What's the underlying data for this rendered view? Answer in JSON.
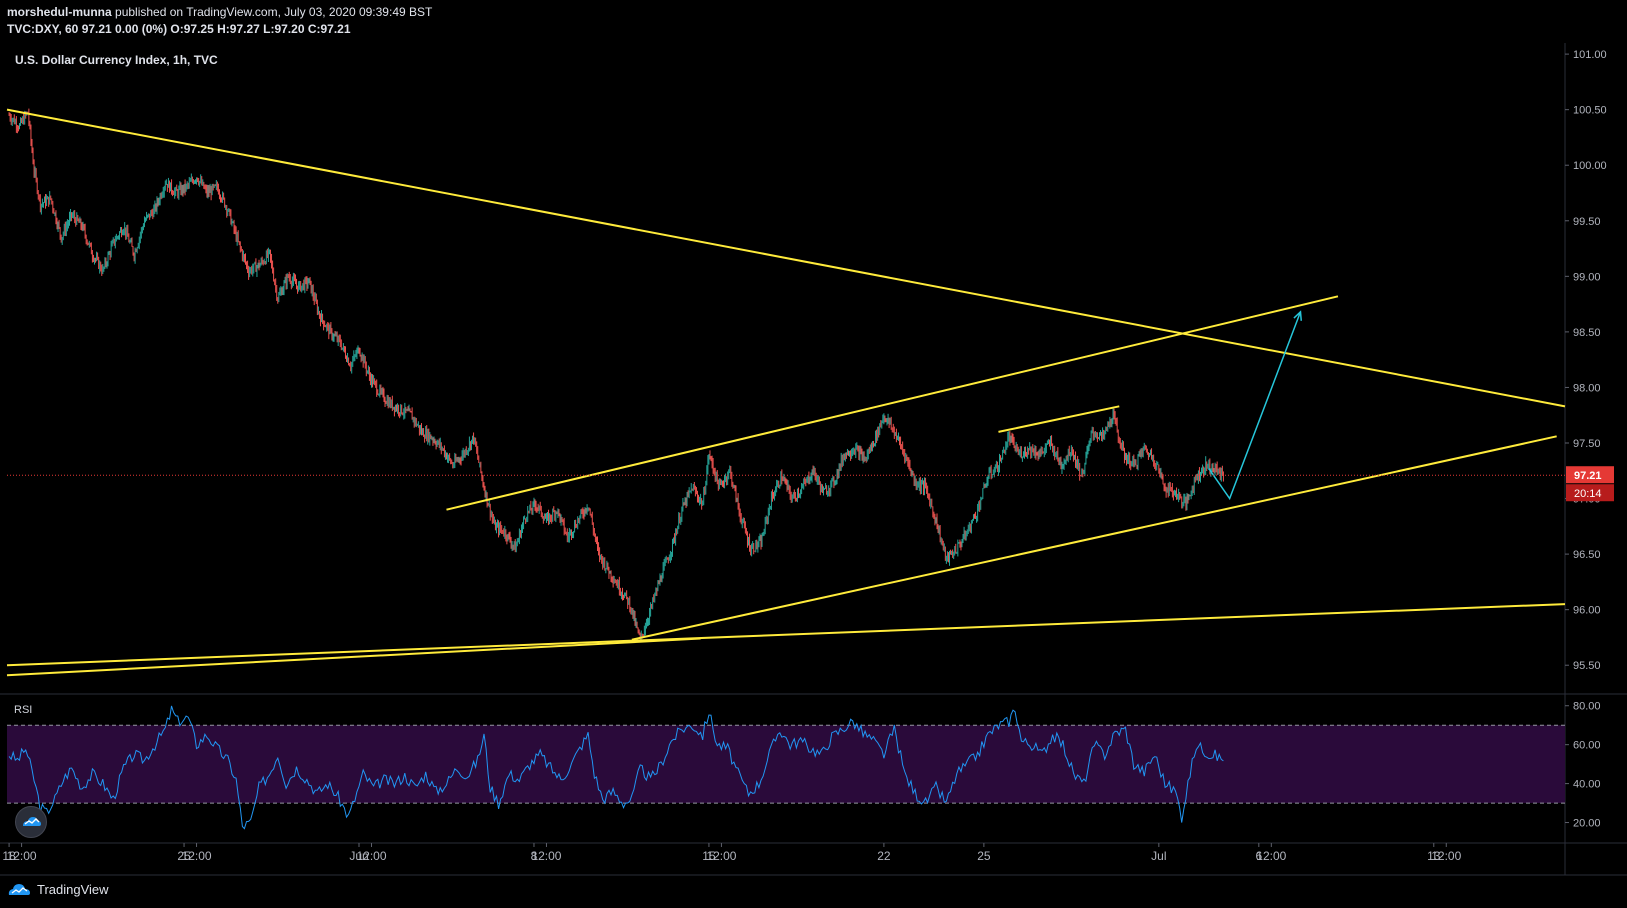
{
  "header": {
    "author": "morshedul-munna",
    "published_text": "published on TradingView.com, July 03, 2020 09:39:49 BST",
    "ticker_line": "TVC:DXY, 60  97.21  0.00 (0%)  O:97.25  H:97.27  L:97.20  C:97.21"
  },
  "chart_title": "U.S. Dollar Currency Index, 1h, TVC",
  "footer": {
    "brand": "TradingView"
  },
  "colors": {
    "background": "#000000",
    "candle_up": "#26a69a",
    "candle_down": "#ef5350",
    "trendline": "#ffeb3b",
    "projection_arrow": "#26c6da",
    "rsi_line": "#2196f3",
    "rsi_band": "#2a0a3a",
    "price_badge": "#e53935"
  },
  "icons": {
    "logo": "tradingview-cloud-icon",
    "badge": "tradingview-badge-icon"
  },
  "chart_data": [
    {
      "type": "candlestick",
      "title": "U.S. Dollar Currency Index, 1h, TVC",
      "symbol": "TVC:DXY",
      "interval": "60",
      "last_price": 97.21,
      "last_price_label": "97.21",
      "countdown_label": "20:14",
      "ylim": [
        95.25,
        101.1
      ],
      "y_ticks": [
        "101.00",
        "100.50",
        "100.00",
        "99.50",
        "99.00",
        "98.50",
        "98.00",
        "97.50",
        "97.00",
        "96.50",
        "96.00",
        "95.50"
      ],
      "x_tick_labels": [
        "18",
        "12:00",
        "25",
        "12:00",
        "Jun",
        "12:00",
        "8",
        "12:00",
        "15",
        "12:00",
        "22",
        "25",
        "Jul",
        "6",
        "12:00",
        "13",
        "12:00"
      ],
      "x_tick_times": [
        0,
        12,
        168,
        180,
        336,
        348,
        504,
        516,
        672,
        684,
        840,
        936,
        1104,
        1200,
        1212,
        1368,
        1380
      ],
      "xlim": [
        -2,
        1494
      ],
      "price_path": [
        [
          0,
          100.45
        ],
        [
          10,
          100.35
        ],
        [
          18,
          100.48
        ],
        [
          24,
          99.95
        ],
        [
          30,
          99.65
        ],
        [
          40,
          99.7
        ],
        [
          50,
          99.35
        ],
        [
          60,
          99.55
        ],
        [
          70,
          99.45
        ],
        [
          80,
          99.2
        ],
        [
          90,
          99.05
        ],
        [
          100,
          99.3
        ],
        [
          110,
          99.45
        ],
        [
          120,
          99.2
        ],
        [
          130,
          99.5
        ],
        [
          140,
          99.6
        ],
        [
          150,
          99.85
        ],
        [
          160,
          99.75
        ],
        [
          170,
          99.8
        ],
        [
          180,
          99.9
        ],
        [
          190,
          99.75
        ],
        [
          200,
          99.8
        ],
        [
          210,
          99.6
        ],
        [
          220,
          99.3
        ],
        [
          230,
          99.05
        ],
        [
          240,
          99.1
        ],
        [
          250,
          99.2
        ],
        [
          258,
          98.8
        ],
        [
          268,
          99.0
        ],
        [
          278,
          98.9
        ],
        [
          288,
          98.95
        ],
        [
          298,
          98.65
        ],
        [
          308,
          98.5
        ],
        [
          318,
          98.4
        ],
        [
          328,
          98.2
        ],
        [
          336,
          98.35
        ],
        [
          346,
          98.1
        ],
        [
          356,
          97.95
        ],
        [
          366,
          97.85
        ],
        [
          376,
          97.8
        ],
        [
          386,
          97.75
        ],
        [
          396,
          97.6
        ],
        [
          406,
          97.55
        ],
        [
          416,
          97.45
        ],
        [
          426,
          97.3
        ],
        [
          436,
          97.4
        ],
        [
          446,
          97.55
        ],
        [
          456,
          97.1
        ],
        [
          466,
          96.75
        ],
        [
          476,
          96.7
        ],
        [
          486,
          96.55
        ],
        [
          496,
          96.85
        ],
        [
          506,
          96.95
        ],
        [
          516,
          96.8
        ],
        [
          526,
          96.9
        ],
        [
          536,
          96.65
        ],
        [
          546,
          96.8
        ],
        [
          556,
          96.95
        ],
        [
          566,
          96.5
        ],
        [
          576,
          96.35
        ],
        [
          586,
          96.2
        ],
        [
          596,
          96.05
        ],
        [
          606,
          95.72
        ],
        [
          616,
          96.0
        ],
        [
          626,
          96.3
        ],
        [
          636,
          96.55
        ],
        [
          646,
          96.9
        ],
        [
          656,
          97.1
        ],
        [
          666,
          96.95
        ],
        [
          672,
          97.4
        ],
        [
          682,
          97.1
        ],
        [
          692,
          97.25
        ],
        [
          702,
          96.85
        ],
        [
          712,
          96.55
        ],
        [
          722,
          96.6
        ],
        [
          732,
          97.0
        ],
        [
          742,
          97.2
        ],
        [
          752,
          97.0
        ],
        [
          762,
          97.1
        ],
        [
          772,
          97.25
        ],
        [
          782,
          97.05
        ],
        [
          792,
          97.15
        ],
        [
          802,
          97.4
        ],
        [
          812,
          97.45
        ],
        [
          822,
          97.35
        ],
        [
          832,
          97.55
        ],
        [
          840,
          97.75
        ],
        [
          850,
          97.6
        ],
        [
          860,
          97.4
        ],
        [
          870,
          97.15
        ],
        [
          880,
          97.1
        ],
        [
          890,
          96.8
        ],
        [
          900,
          96.45
        ],
        [
          910,
          96.55
        ],
        [
          920,
          96.7
        ],
        [
          930,
          96.9
        ],
        [
          940,
          97.2
        ],
        [
          950,
          97.3
        ],
        [
          960,
          97.55
        ],
        [
          970,
          97.4
        ],
        [
          980,
          97.45
        ],
        [
          990,
          97.4
        ],
        [
          1000,
          97.5
        ],
        [
          1010,
          97.3
        ],
        [
          1020,
          97.45
        ],
        [
          1030,
          97.2
        ],
        [
          1040,
          97.6
        ],
        [
          1050,
          97.55
        ],
        [
          1060,
          97.75
        ],
        [
          1070,
          97.4
        ],
        [
          1080,
          97.3
        ],
        [
          1090,
          97.45
        ],
        [
          1100,
          97.35
        ],
        [
          1110,
          97.1
        ],
        [
          1120,
          97.05
        ],
        [
          1130,
          96.95
        ],
        [
          1140,
          97.2
        ],
        [
          1150,
          97.3
        ],
        [
          1160,
          97.25
        ],
        [
          1166,
          97.21
        ]
      ],
      "trendlines": [
        {
          "name": "long-term-resistance",
          "p1": [
            -2,
            100.5
          ],
          "p2": [
            1494,
            97.83
          ]
        },
        {
          "name": "channel-upper",
          "p1": [
            420,
            96.9
          ],
          "p2": [
            1276,
            98.82
          ]
        },
        {
          "name": "channel-lower",
          "p1": [
            598,
            95.73
          ],
          "p2": [
            1486,
            97.56
          ]
        },
        {
          "name": "short-resistance",
          "p1": [
            950,
            97.6
          ],
          "p2": [
            1066,
            97.83
          ]
        },
        {
          "name": "long-term-support-a",
          "p1": [
            -2,
            95.5
          ],
          "p2": [
            1494,
            96.05
          ]
        },
        {
          "name": "long-term-support-b",
          "p1": [
            -2,
            95.41
          ],
          "p2": [
            664,
            95.74
          ]
        }
      ],
      "projection": [
        [
          1152,
          97.27
        ],
        [
          1172,
          97.0
        ],
        [
          1240,
          98.68
        ]
      ]
    },
    {
      "type": "line",
      "title": "RSI",
      "ylim": [
        10,
        85
      ],
      "y_ticks": [
        "80.00",
        "60.00",
        "40.00",
        "20.00"
      ],
      "bands": [
        30,
        70
      ],
      "xlim": [
        -2,
        1494
      ],
      "rsi_path": [
        [
          0,
          55
        ],
        [
          8,
          52
        ],
        [
          16,
          58
        ],
        [
          24,
          42
        ],
        [
          30,
          28
        ],
        [
          36,
          25
        ],
        [
          44,
          32
        ],
        [
          52,
          42
        ],
        [
          60,
          48
        ],
        [
          70,
          38
        ],
        [
          80,
          45
        ],
        [
          90,
          40
        ],
        [
          100,
          32
        ],
        [
          110,
          48
        ],
        [
          120,
          55
        ],
        [
          130,
          52
        ],
        [
          140,
          60
        ],
        [
          150,
          68
        ],
        [
          156,
          78
        ],
        [
          162,
          72
        ],
        [
          172,
          74
        ],
        [
          180,
          60
        ],
        [
          190,
          65
        ],
        [
          200,
          58
        ],
        [
          210,
          52
        ],
        [
          218,
          42
        ],
        [
          224,
          18
        ],
        [
          232,
          20
        ],
        [
          240,
          38
        ],
        [
          250,
          45
        ],
        [
          258,
          55
        ],
        [
          266,
          40
        ],
        [
          276,
          48
        ],
        [
          286,
          42
        ],
        [
          296,
          35
        ],
        [
          306,
          40
        ],
        [
          316,
          33
        ],
        [
          326,
          23
        ],
        [
          332,
          32
        ],
        [
          340,
          45
        ],
        [
          350,
          38
        ],
        [
          360,
          42
        ],
        [
          370,
          40
        ],
        [
          380,
          44
        ],
        [
          390,
          38
        ],
        [
          400,
          45
        ],
        [
          410,
          36
        ],
        [
          420,
          40
        ],
        [
          430,
          48
        ],
        [
          440,
          44
        ],
        [
          450,
          52
        ],
        [
          456,
          65
        ],
        [
          462,
          38
        ],
        [
          470,
          30
        ],
        [
          480,
          45
        ],
        [
          490,
          42
        ],
        [
          500,
          50
        ],
        [
          510,
          55
        ],
        [
          520,
          48
        ],
        [
          530,
          42
        ],
        [
          540,
          50
        ],
        [
          550,
          60
        ],
        [
          556,
          65
        ],
        [
          562,
          45
        ],
        [
          570,
          32
        ],
        [
          580,
          36
        ],
        [
          590,
          30
        ],
        [
          598,
          32
        ],
        [
          606,
          48
        ],
        [
          616,
          42
        ],
        [
          626,
          50
        ],
        [
          636,
          62
        ],
        [
          646,
          68
        ],
        [
          656,
          70
        ],
        [
          666,
          65
        ],
        [
          672,
          77
        ],
        [
          680,
          60
        ],
        [
          690,
          58
        ],
        [
          700,
          45
        ],
        [
          710,
          35
        ],
        [
          720,
          40
        ],
        [
          730,
          55
        ],
        [
          740,
          68
        ],
        [
          750,
          60
        ],
        [
          760,
          62
        ],
        [
          770,
          58
        ],
        [
          780,
          55
        ],
        [
          790,
          64
        ],
        [
          800,
          68
        ],
        [
          810,
          72
        ],
        [
          820,
          66
        ],
        [
          830,
          62
        ],
        [
          840,
          55
        ],
        [
          850,
          68
        ],
        [
          860,
          45
        ],
        [
          870,
          35
        ],
        [
          880,
          30
        ],
        [
          890,
          38
        ],
        [
          900,
          30
        ],
        [
          910,
          45
        ],
        [
          920,
          50
        ],
        [
          930,
          55
        ],
        [
          940,
          65
        ],
        [
          950,
          70
        ],
        [
          960,
          72
        ],
        [
          966,
          79
        ],
        [
          972,
          62
        ],
        [
          982,
          60
        ],
        [
          992,
          55
        ],
        [
          1002,
          65
        ],
        [
          1012,
          60
        ],
        [
          1022,
          45
        ],
        [
          1032,
          40
        ],
        [
          1042,
          60
        ],
        [
          1052,
          55
        ],
        [
          1062,
          66
        ],
        [
          1072,
          68
        ],
        [
          1080,
          50
        ],
        [
          1090,
          46
        ],
        [
          1100,
          55
        ],
        [
          1110,
          40
        ],
        [
          1120,
          36
        ],
        [
          1126,
          23
        ],
        [
          1132,
          40
        ],
        [
          1140,
          60
        ],
        [
          1150,
          56
        ],
        [
          1160,
          54
        ],
        [
          1166,
          52
        ]
      ]
    }
  ]
}
